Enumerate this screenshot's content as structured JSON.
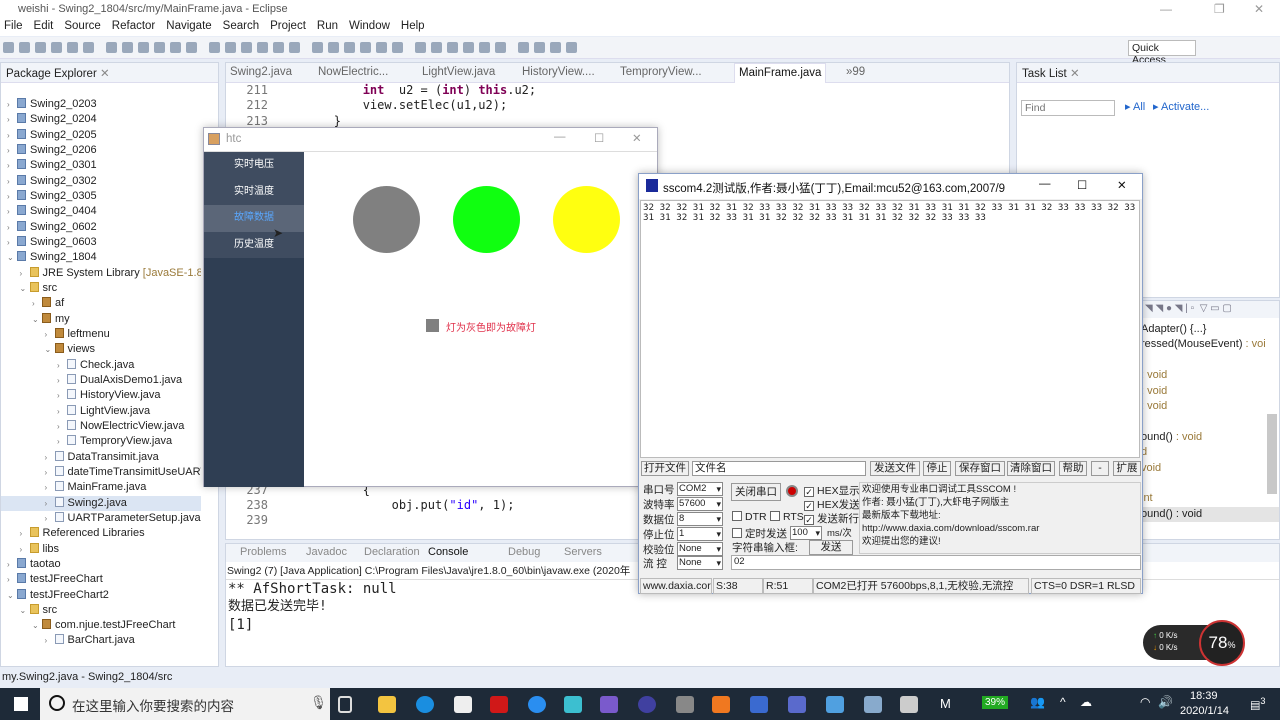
{
  "window": {
    "title": "weishi - Swing2_1804/src/my/MainFrame.java - Eclipse"
  },
  "menu": [
    "File",
    "Edit",
    "Source",
    "Refactor",
    "Navigate",
    "Search",
    "Project",
    "Run",
    "Window",
    "Help"
  ],
  "toolbar": {
    "quick_access": "Quick Access"
  },
  "package_explorer": {
    "title": "Package Explorer",
    "items": [
      {
        "label": "Swing2_0203",
        "level": 0,
        "kind": "proj",
        "arrow": "›"
      },
      {
        "label": "Swing2_0204",
        "level": 0,
        "kind": "proj",
        "arrow": "›"
      },
      {
        "label": "Swing2_0205",
        "level": 0,
        "kind": "proj",
        "arrow": "›"
      },
      {
        "label": "Swing2_0206",
        "level": 0,
        "kind": "proj",
        "arrow": "›"
      },
      {
        "label": "Swing2_0301",
        "level": 0,
        "kind": "proj",
        "arrow": "›"
      },
      {
        "label": "Swing2_0302",
        "level": 0,
        "kind": "proj",
        "arrow": "›"
      },
      {
        "label": "Swing2_0305",
        "level": 0,
        "kind": "proj",
        "arrow": "›"
      },
      {
        "label": "Swing2_0404",
        "level": 0,
        "kind": "proj",
        "arrow": "›"
      },
      {
        "label": "Swing2_0602",
        "level": 0,
        "kind": "proj",
        "arrow": "›"
      },
      {
        "label": "Swing2_0603",
        "level": 0,
        "kind": "proj",
        "arrow": "›"
      },
      {
        "label": "Swing2_1804",
        "level": 0,
        "kind": "proj",
        "arrow": "⌄"
      },
      {
        "label": "JRE System Library",
        "suffix": "[JavaSE-1.8]",
        "level": 1,
        "kind": "folder",
        "arrow": "›"
      },
      {
        "label": "src",
        "level": 1,
        "kind": "folder",
        "arrow": "⌄"
      },
      {
        "label": "af",
        "level": 2,
        "kind": "pkg",
        "arrow": "›"
      },
      {
        "label": "my",
        "level": 2,
        "kind": "pkg",
        "arrow": "⌄"
      },
      {
        "label": "leftmenu",
        "level": 3,
        "kind": "pkg",
        "arrow": "›"
      },
      {
        "label": "views",
        "level": 3,
        "kind": "pkg",
        "arrow": "⌄"
      },
      {
        "label": "Check.java",
        "level": 4,
        "kind": "file",
        "arrow": "›"
      },
      {
        "label": "DualAxisDemo1.java",
        "level": 4,
        "kind": "file",
        "arrow": "›"
      },
      {
        "label": "HistoryView.java",
        "level": 4,
        "kind": "file",
        "arrow": "›"
      },
      {
        "label": "LightView.java",
        "level": 4,
        "kind": "file",
        "arrow": "›"
      },
      {
        "label": "NowElectricView.java",
        "level": 4,
        "kind": "file",
        "arrow": "›"
      },
      {
        "label": "TemproryView.java",
        "level": 4,
        "kind": "file",
        "arrow": "›"
      },
      {
        "label": "DataTransimit.java",
        "level": 3,
        "kind": "file",
        "arrow": "›"
      },
      {
        "label": "dateTimeTransimitUseUART",
        "level": 3,
        "kind": "file",
        "arrow": "›"
      },
      {
        "label": "MainFrame.java",
        "level": 3,
        "kind": "file",
        "arrow": "›"
      },
      {
        "label": "Swing2.java",
        "level": 3,
        "kind": "file",
        "arrow": "›",
        "selected": true
      },
      {
        "label": "UARTParameterSetup.java",
        "level": 3,
        "kind": "file",
        "arrow": "›"
      },
      {
        "label": "Referenced Libraries",
        "level": 1,
        "kind": "folder",
        "arrow": "›"
      },
      {
        "label": "libs",
        "level": 1,
        "kind": "folder",
        "arrow": "›"
      },
      {
        "label": "taotao",
        "level": 0,
        "kind": "proj",
        "arrow": "›"
      },
      {
        "label": "testJFreeChart",
        "level": 0,
        "kind": "proj",
        "arrow": "›"
      },
      {
        "label": "testJFreeChart2",
        "level": 0,
        "kind": "proj",
        "arrow": "⌄"
      },
      {
        "label": "src",
        "level": 1,
        "kind": "folder",
        "arrow": "⌄"
      },
      {
        "label": "com.njue.testJFreeChart",
        "level": 2,
        "kind": "pkg",
        "arrow": "⌄"
      },
      {
        "label": "BarChart.java",
        "level": 3,
        "kind": "file",
        "arrow": "›"
      }
    ]
  },
  "editor": {
    "tabs": [
      "Swing2.java",
      "NowElectric...",
      "LightView.java",
      "HistoryView....",
      "TemproryView...",
      "MainFrame.java",
      "»99"
    ],
    "active_tab": "MainFrame.java",
    "lines": [
      {
        "n": "211",
        "pre": "            ",
        "k1": "int",
        "mid": "  u2 = (",
        "k2": "int",
        "mid2": ") ",
        "k3": "this",
        "post": ".u2;"
      },
      {
        "n": "212",
        "text": "            view.setElec(u1,u2);"
      },
      {
        "n": "213",
        "text": "        }"
      },
      {
        "n": "237",
        "text": "            {"
      },
      {
        "n": "238",
        "pre": "                obj.put(",
        "s": "\"id\"",
        "post": ", 1);"
      },
      {
        "n": "239",
        "text": ""
      }
    ]
  },
  "task_list": {
    "title": "Task List",
    "find_placeholder": "Find",
    "all": "All",
    "activate": "Activate..."
  },
  "outline": {
    "rows": [
      {
        "a": "Adapter() {...}",
        "b": ""
      },
      {
        "a": "ressed(MouseEvent)",
        "b": " : voi"
      },
      {
        "a": "",
        "b": ""
      },
      {
        "a": "",
        "b": ": void"
      },
      {
        "a": "",
        "b": ": void"
      },
      {
        "a": "",
        "b": ": void"
      },
      {
        "a": "",
        "b": ""
      },
      {
        "a": "ound()",
        "b": " : void"
      },
      {
        "a": "",
        "b": "d"
      },
      {
        "a": "",
        "b": "void"
      },
      {
        "a": "",
        "b": ""
      },
      {
        "a": "",
        "b": "int"
      },
      {
        "a": "ound() : void",
        "b": ""
      }
    ]
  },
  "console": {
    "tabs": [
      "Problems",
      "Javadoc",
      "Declaration",
      "Console",
      "Debug",
      "Servers"
    ],
    "header": "Swing2 (7) [Java Application] C:\\Program Files\\Java\\jre1.8.0_60\\bin\\javaw.exe (2020年",
    "lines": [
      "** AfShortTask: null",
      "数据已发送完毕!",
      "[1]"
    ]
  },
  "status": "my.Swing2.java - Swing2_1804/src",
  "htc": {
    "title": "htc",
    "menu": [
      "实时电压",
      "实时温度",
      "故障数据",
      "历史温度"
    ],
    "active": 2,
    "lamps": [
      {
        "color": "#808080",
        "state": "fault"
      },
      {
        "color": "#10ff10",
        "state": "on"
      },
      {
        "color": "#ffff10",
        "state": "on"
      }
    ],
    "legend": "灯为灰色即为故障灯",
    "legend_color": "#808080",
    "legend_text_color": "#e0304a"
  },
  "sscom": {
    "title": "sscom4.2测试版,作者:聂小猛(丁丁),Email:mcu52@163.com,2007/9",
    "received": "32 32 32 31 32 31 32 33 33 32 31 33 33 32 33 32 31 33 31 31 32 33 31 31 32 33 33 33 32 33 31 31 32 31 32 33 31 31 32 32 32 33 31 31 31 32 32 32 33 33 33",
    "open_file": "打开文件",
    "filename": "文件名",
    "send_file": "发送文件",
    "stop": "停止",
    "save_window": "保存窗口",
    "clear_window": "清除窗口",
    "help": "帮助",
    "minus": "-",
    "expand": "扩展",
    "port_label": "串口号",
    "port": "COM2",
    "baud_label": "波特率",
    "baud": "57600",
    "data_label": "数据位",
    "data_bits": "8",
    "stop_label": "停止位",
    "stop_bits": "1",
    "parity_label": "校验位",
    "parity": "None",
    "flow_label": "流 控",
    "flow": "None",
    "close_port": "关闭串口",
    "hex_display": "HEX显示",
    "hex_send": "HEX发送",
    "dtr": "DTR",
    "rts": "RTS",
    "send_newline": "发送新行",
    "timed_send": "定时发送",
    "interval": "100",
    "interval_unit": "ms/次",
    "string_input": "字符串输入框:",
    "send": "发送",
    "input_value": "02",
    "info": [
      "欢迎使用专业串口调试工具SSCOM !",
      "作者: 聂小猛(丁丁),大虾电子网版主",
      "最新版本下载地址:",
      "http://www.daxia.com/download/sscom.rar",
      "欢迎提出您的建议!"
    ],
    "status": [
      "www.daxia.cor",
      "S:38",
      "R:51",
      "COM2已打开  57600bps,8,1,无校验,无流控",
      "CTS=0 DSR=1 RLSD"
    ]
  },
  "net_widget": {
    "up": "0",
    "down": "0",
    "unit": "K/s",
    "cpu": "78",
    "cpu_unit": "%"
  },
  "taskbar": {
    "search_placeholder": "在这里输入你要搜索的内容",
    "battery": "39%",
    "time": "18:39",
    "date": "2020/1/14",
    "notifications": "3",
    "ime": "M"
  }
}
